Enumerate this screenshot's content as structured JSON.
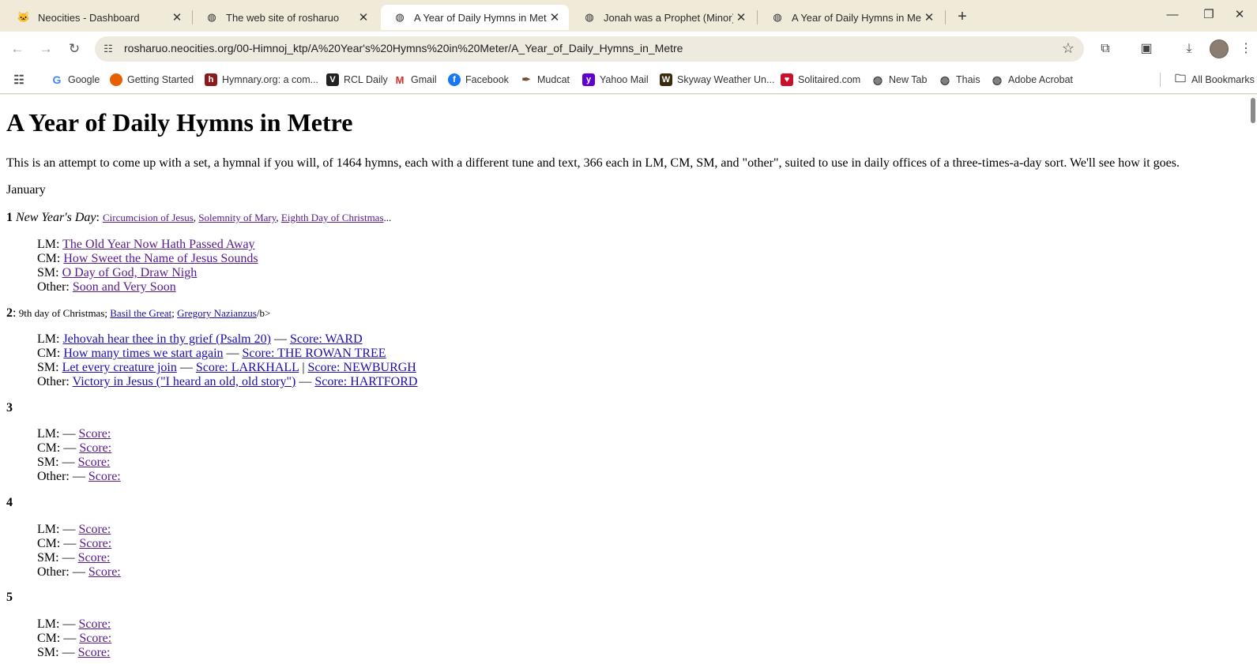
{
  "tabs": [
    {
      "title": "Neocities - Dashboard",
      "icon": "cat-icon"
    },
    {
      "title": "The web site of rosharuo",
      "icon": "globe-icon"
    },
    {
      "title": "A Year of Daily Hymns in Metre",
      "icon": "globe-icon"
    },
    {
      "title": "Jonah was a Prophet (Minor)",
      "icon": "globe-icon"
    },
    {
      "title": "A Year of Daily Hymns in Metre",
      "icon": "globe-icon"
    }
  ],
  "address": {
    "url": "rosharuo.neocities.org/00-Himnoj_ktp/A%20Year's%20Hymns%20in%20Meter/A_Year_of_Daily_Hymns_in_Metre"
  },
  "bookmarks": {
    "items": [
      "Google",
      "Getting Started",
      "Hymnary.org: a com...",
      "RCL Daily",
      "Gmail",
      "Facebook",
      "Mudcat",
      "Yahoo Mail",
      "Skyway Weather Un...",
      "Solitaired.com",
      "New Tab",
      "Thais",
      "Adobe Acrobat"
    ],
    "all": "All Bookmarks"
  },
  "page": {
    "title": "A Year of Daily Hymns in Metre",
    "intro": "This is an attempt to come up with a set, a hymnal if you will, of 1464 hymns, each with a different tune and text, 366 each in LM, CM, SM, and \"other\", suited to use in daily offices of a three-times-a-day sort. We'll see how it goes.",
    "month": "January",
    "day1": {
      "num": "1",
      "name": "New Year's Day",
      "colon": ": ",
      "links": [
        "Circumcision of Jesus",
        "Solemnity of Mary",
        "Eighth Day of Christmas"
      ],
      "sep": ", ",
      "ellipsis": "...",
      "lm_label": "LM: ",
      "lm": "The Old Year Now Hath Passed Away",
      "cm_label": "CM: ",
      "cm": "How Sweet the Name of Jesus Sounds",
      "sm_label": "SM: ",
      "sm": "O Day of God, Draw Nigh",
      "other_label": "Other: ",
      "other": "Soon and Very Soon"
    },
    "day2": {
      "num": "2",
      "colon": ":",
      "text": " 9th day of Christmas; ",
      "link1": "Basil the Great",
      "semi": "; ",
      "link2": "Gregory Nazianzus",
      "tail": "/b>",
      "lm_label": "LM: ",
      "lm": "Jehovah hear thee in thy grief (Psalm 20)",
      "lm_score": "Score: WARD",
      "cm_label": "CM: ",
      "cm": "How many times we start again",
      "cm_score": "Score: THE ROWAN TREE",
      "sm_label": "SM: ",
      "sm": "Let every creature join",
      "sm_score1": "Score: LARKHALL",
      "sm_score2": "Score: NEWBURGH",
      "other_label": "Other: ",
      "other": "Victory in Jesus (\"I heard an old, old story\")",
      "other_score": "Score: HARTFORD",
      "dash": " — ",
      "pipe": " | "
    },
    "empty_days": [
      "3",
      "4",
      "5"
    ],
    "empty_lines": {
      "lm": "LM: — ",
      "cm": "CM: — ",
      "sm": "SM: — ",
      "other": "Other: — ",
      "score": "Score:"
    }
  }
}
